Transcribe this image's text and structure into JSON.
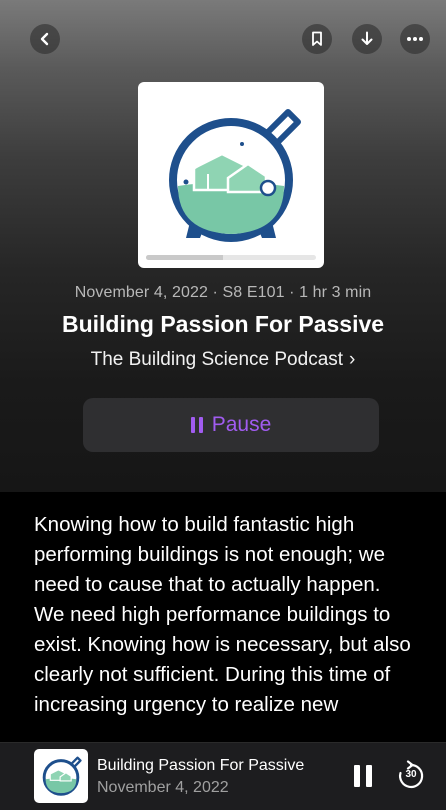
{
  "header": {
    "back_icon": "chevron-left-icon",
    "bookmark_icon": "bookmark-icon",
    "download_icon": "arrow-down-icon",
    "more_icon": "ellipsis-icon"
  },
  "episode": {
    "meta": "November 4, 2022 · S8 E101 · 1 hr 3 min",
    "title": "Building Passion For Passive",
    "show": "The Building Science Podcast",
    "show_chevron": "›",
    "playback_progress": 0.45
  },
  "actions": {
    "pause_label": "Pause",
    "accent_color": "#a15cf0"
  },
  "description": "Knowing how to build fantastic high performing buildings is not enough; we need to cause that to actually happen. We need high performance buildings to exist. Knowing how is necessary, but also clearly not sufficient. During this time of increasing urgency to realize new",
  "mini_player": {
    "title": "Building Passion For Passive",
    "date": "November 4, 2022",
    "skip_label": "30",
    "pause_icon": "pause-icon",
    "skip_icon": "skip-forward-30-icon"
  }
}
